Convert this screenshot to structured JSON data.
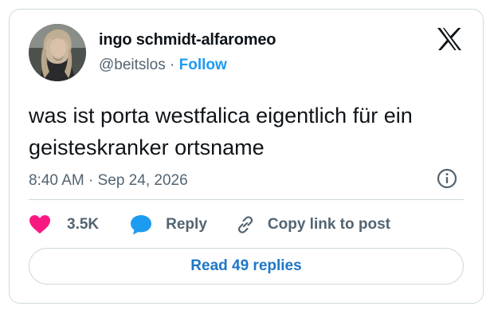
{
  "tweet": {
    "author": {
      "display_name": "ingo schmidt-alfaromeo",
      "handle": "@beitslos",
      "separator": "·",
      "follow_label": "Follow"
    },
    "text": "was ist porta westfalica eigentlich für ein geisteskranker ortsname",
    "timestamp": "8:40 AM · Sep 24, 2026",
    "actions": {
      "likes": "3.5K",
      "reply_label": "Reply",
      "copy_link_label": "Copy link to post"
    },
    "read_replies_label": "Read 49 replies"
  },
  "icons": {
    "brand": "x-logo-icon",
    "info": "info-icon",
    "like": "heart-icon",
    "reply": "speech-bubble-icon",
    "copy_link": "link-icon"
  },
  "colors": {
    "accent": "#1d9bf0",
    "like": "#f91880",
    "secondary_text": "#536471",
    "border": "#cfd9de"
  }
}
